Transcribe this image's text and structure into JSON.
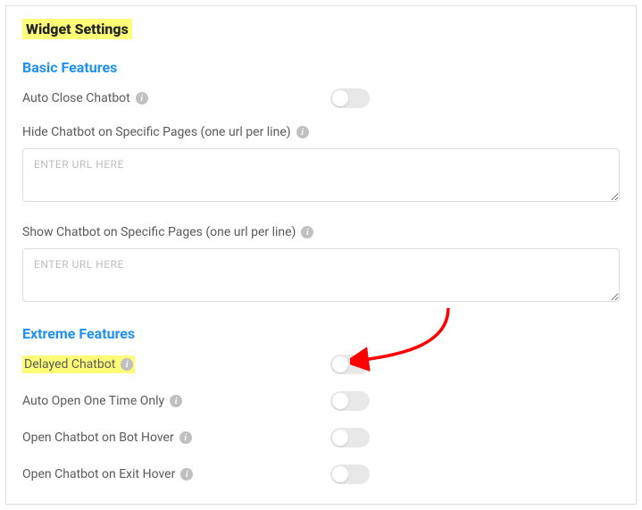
{
  "title": "Widget Settings",
  "sections": {
    "basic": {
      "heading": "Basic Features",
      "auto_close": "Auto Close Chatbot",
      "hide_pages_label": "Hide Chatbot on Specific Pages (one url per line)",
      "hide_pages_placeholder": "ENTER URL HERE",
      "show_pages_label": "Show Chatbot on Specific Pages (one url per line)",
      "show_pages_placeholder": "ENTER URL HERE"
    },
    "extreme": {
      "heading": "Extreme Features",
      "delayed": "Delayed Chatbot",
      "auto_open_once": "Auto Open One Time Only",
      "open_bot_hover": "Open Chatbot on Bot Hover",
      "open_exit_hover": "Open Chatbot on Exit Hover"
    }
  }
}
